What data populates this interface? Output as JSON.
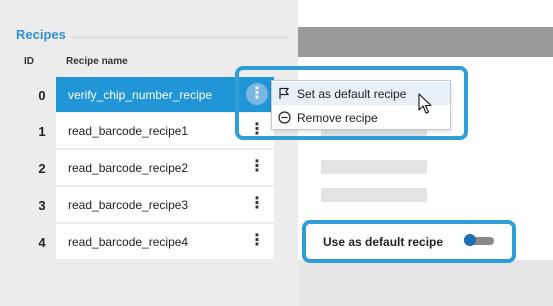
{
  "recipes": {
    "title": "Recipes",
    "columns": {
      "id": "ID",
      "name": "Recipe name"
    },
    "rows": [
      {
        "id": "0",
        "name": "verify_chip_number_recipe",
        "selected": true
      },
      {
        "id": "1",
        "name": "read_barcode_recipe1",
        "selected": false
      },
      {
        "id": "2",
        "name": "read_barcode_recipe2",
        "selected": false
      },
      {
        "id": "3",
        "name": "read_barcode_recipe3",
        "selected": false
      },
      {
        "id": "4",
        "name": "read_barcode_recipe4",
        "selected": false
      }
    ],
    "row_menu_glyph": "⋮"
  },
  "context_menu": {
    "items": [
      {
        "label": "Set as default recipe",
        "icon": "flag-icon"
      },
      {
        "label": "Remove recipe",
        "icon": "minus-circle-icon"
      }
    ]
  },
  "settings": {
    "default_label": "Use as default recipe",
    "default_on": false
  },
  "colors": {
    "accent": "#2196d6",
    "highlight": "#2f9ed8",
    "title": "#2f8fd6"
  }
}
